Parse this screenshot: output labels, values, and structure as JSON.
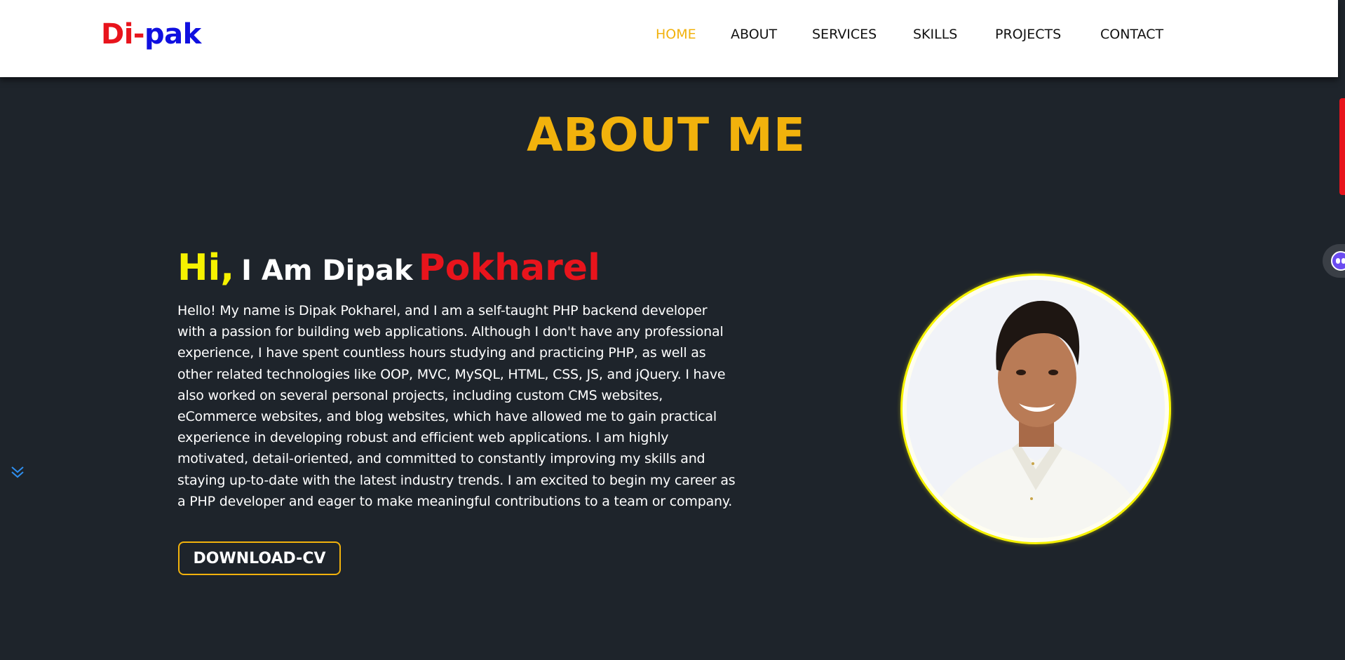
{
  "brand": {
    "part1": "Di-",
    "part2": "pak"
  },
  "nav": {
    "items": [
      {
        "label": "HOME",
        "active": true
      },
      {
        "label": "ABOUT",
        "active": false
      },
      {
        "label": "SERVICES",
        "active": false
      },
      {
        "label": "SKILLS",
        "active": false
      },
      {
        "label": "PROJECTS",
        "active": false
      },
      {
        "label": "CONTACT",
        "active": false
      }
    ]
  },
  "about": {
    "title": "ABOUT ME",
    "greeting_hi": "Hi,",
    "greeting_mid": "I Am Dipak",
    "greeting_last": "Pokharel",
    "bio": "Hello! My name is Dipak Pokharel, and I am a self-taught PHP backend developer with a passion for building web applications. Although I don't have any professional experience, I have spent countless hours studying and practicing PHP, as well as other related technologies like OOP, MVC, MySQL, HTML, CSS, JS, and jQuery. I have also worked on several personal projects, including custom CMS websites, eCommerce websites, and blog websites, which have allowed me to gain practical experience in developing robust and efficient web applications. I am highly motivated, detail-oriented, and committed to constantly improving my skills and staying up-to-date with the latest industry trends. I am excited to begin my career as a PHP developer and eager to make meaningful contributions to a team or company.",
    "cv_button": "DOWNLOAD-CV"
  },
  "icons": {
    "scroll_down": "double-chevron-down-icon",
    "chat": "chat-bot-icon"
  },
  "colors": {
    "background": "#1e242b",
    "accent": "#f2b20c",
    "hi_yellow": "#f6f200",
    "brand_red": "#e8141c",
    "brand_blue": "#1010e0"
  }
}
